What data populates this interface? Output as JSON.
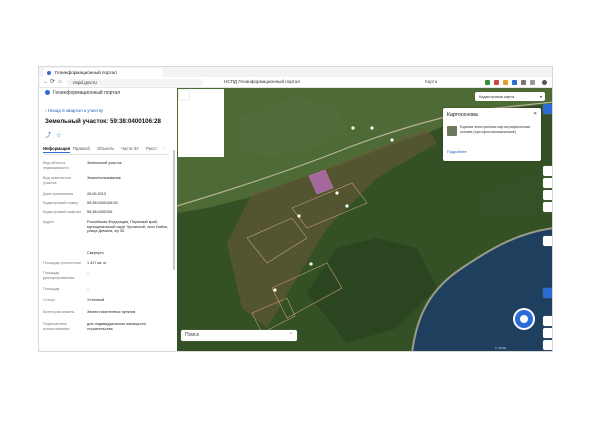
{
  "browser": {
    "tab_title": "Геоинформационный портал",
    "url": "nspd.gov.ru",
    "window_title": "НСПД Геоинформационный портал",
    "extension_label": "Карта"
  },
  "panel": {
    "header": "Геоинформационный портал",
    "back_link": "Назад в квартал к участку",
    "title": "Земельный участок: 59:38:0400106:28",
    "tabs": [
      "Информация",
      "Правооб",
      "Объекты",
      "Части ЗУ",
      "Расст"
    ],
    "fields": [
      {
        "key": "Вид объекта недвижимости",
        "value": "Земельный участок"
      },
      {
        "key": "Вид земельного участка",
        "value": "Землепользование"
      },
      {
        "key": "Дата присвоения",
        "value": "26.06.2013"
      },
      {
        "key": "Кадастровый номер",
        "value": "59:38:0400106:28"
      },
      {
        "key": "Кадастровый квартал",
        "value": "59:38:0400106"
      },
      {
        "key": "Адрес",
        "value": "Российская Федерация, Пермский край, муниципальный округ Чусовской, село Бабка, улица Демина, з/у 30"
      },
      {
        "key": "Площадь уточненная",
        "value": "1 417 кв. м"
      },
      {
        "key": "Площадь декларированная",
        "value": "–"
      },
      {
        "key": "Площадь",
        "value": "–"
      },
      {
        "key": "Статус",
        "value": "Учтенный"
      },
      {
        "key": "Категория земель",
        "value": "Земли населенных пунктов"
      },
      {
        "key": "Разрешенное использование",
        "value": "для индивидуального жилищного строительства"
      }
    ],
    "show_more": "Свернуть"
  },
  "map": {
    "layer_select": "Кадастровая карта",
    "card": {
      "title": "Картоосновa",
      "description": "Единая электронная картографическая основа (ортофото/космические)",
      "link": "Подробнее"
    },
    "search_placeholder": "Поиск",
    "copyright": "© НСПД"
  },
  "colors": {
    "accent": "#2b6cd6",
    "parcel_highlight": "#d070d8",
    "water": "#1f3f5e",
    "forest": "#2f4a22"
  }
}
